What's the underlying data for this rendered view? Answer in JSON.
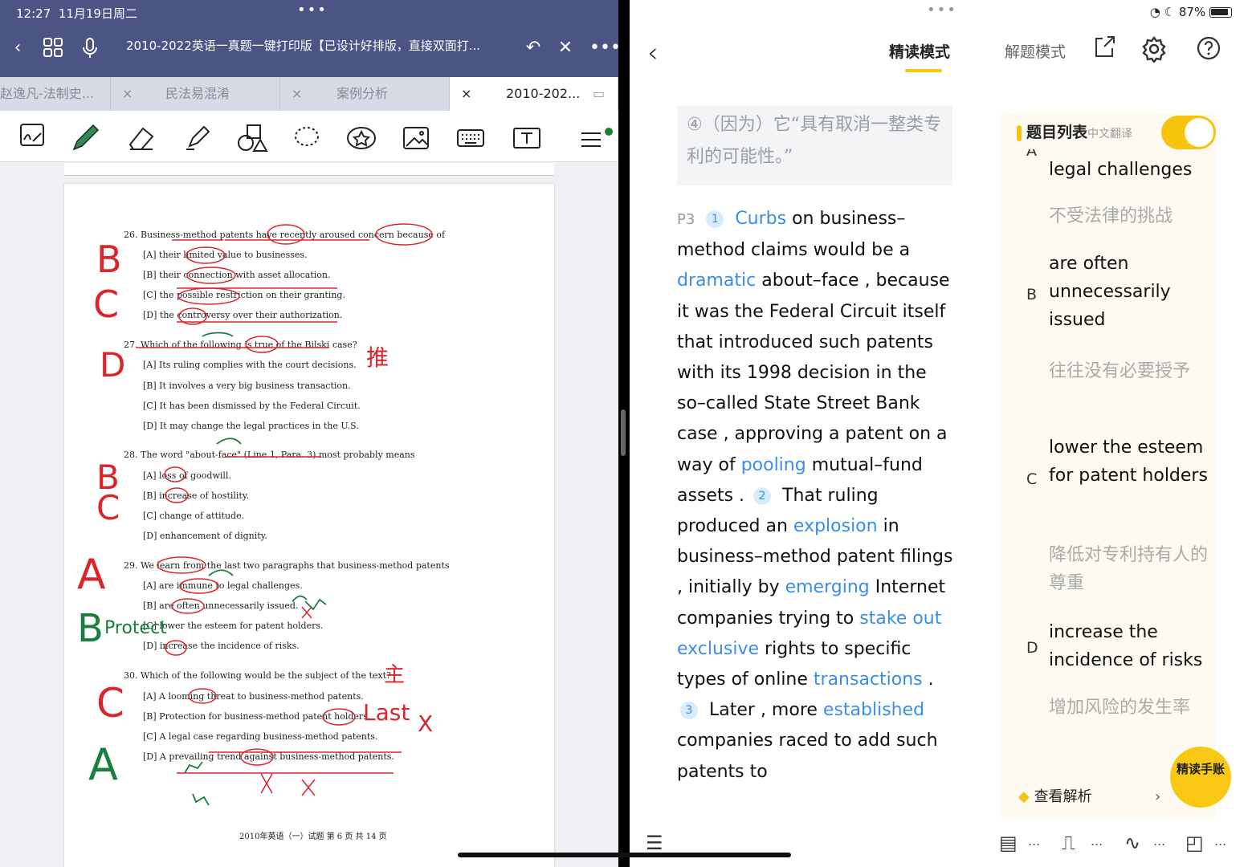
{
  "left": {
    "status": {
      "time": "12:27",
      "date": "11月19日周二",
      "dots": "•••"
    },
    "title": "2010-2022英语一真题一键打印版【已设计好排版，直接双面打...",
    "tabs": [
      {
        "label": "赵逸凡-法制史...",
        "close": "×"
      },
      {
        "label": "民法易混淆",
        "close": "×"
      },
      {
        "label": "案例分析",
        "close": "×"
      },
      {
        "label": "2010-202...",
        "close": "×"
      }
    ],
    "page": {
      "questions": [
        {
          "stem": "26. Business-method patents have recently aroused concern because of",
          "options": [
            "[A] their limited value to businesses.",
            "[B] their connection with asset allocation.",
            "[C] the possible restriction on their granting.",
            "[D] the controversy over their authorization."
          ]
        },
        {
          "stem": "27. Which of the following is true of the Bilski case?",
          "options": [
            "[A] Its ruling complies with the court decisions.",
            "[B] It involves a very big business transaction.",
            "[C] It has been dismissed by the Federal Circuit.",
            "[D] It may change the legal practices in the U.S."
          ]
        },
        {
          "stem": "28. The word \"about-face\" (Line 1, Para. 3) most probably means",
          "options": [
            "[A] loss of goodwill.",
            "[B] increase of hostility.",
            "[C] change of attitude.",
            "[D] enhancement of dignity."
          ]
        },
        {
          "stem": "29. We learn from the last two paragraphs that business-method patents",
          "options": [
            "[A] are immune to legal challenges.",
            "[B] are often unnecessarily issued.",
            "[C] lower the esteem for patent holders.",
            "[D] increase the incidence of risks."
          ]
        },
        {
          "stem": "30. Which of the following would be the subject of the text?",
          "options": [
            "[A] A looming threat to business-method patents.",
            "[B] Protection for business-method patent holders.",
            "[C] A legal case regarding business-method patents.",
            "[D] A prevailing trend against business-method patents."
          ]
        }
      ],
      "footer": "2010年英语（一）试题 第 6 页 共 14 页",
      "handwriting": [
        "B",
        "C",
        "D",
        "推",
        "B",
        "C",
        "A",
        "B",
        "Protect",
        "C",
        "A",
        "Last",
        "主",
        "X"
      ]
    }
  },
  "right": {
    "status": {
      "dots": "•••",
      "battery": "87%"
    },
    "nav": {
      "back": "‹",
      "tab_active": "精读模式",
      "tab_inactive": "解题模式"
    },
    "prev_sentence": "④（因为）它“具有取消一整类专利的可能性。”",
    "passage": [
      {
        "t": "P3",
        "k": "pn"
      },
      {
        "t": "1",
        "k": "badge"
      },
      {
        "t": "Curbs",
        "k": "kw"
      },
      {
        "t": " on business–method claims would be a ",
        "k": ""
      },
      {
        "t": "dramatic",
        "k": "kw"
      },
      {
        "t": " about–face , because it was the Federal Circuit  itself that introduced such patents with its 1998 decision in the so–called State Street Bank  case , approving a patent on a way of ",
        "k": ""
      },
      {
        "t": "pooling",
        "k": "kw"
      },
      {
        "t": " mutual–fund assets . ",
        "k": ""
      },
      {
        "t": "2",
        "k": "badge"
      },
      {
        "t": "That ruling produced an ",
        "k": ""
      },
      {
        "t": "explosion",
        "k": "kw"
      },
      {
        "t": " in business–method patent filings , initially by ",
        "k": ""
      },
      {
        "t": "emerging",
        "k": "kw"
      },
      {
        "t": " Internet companies trying to ",
        "k": ""
      },
      {
        "t": "stake out",
        "k": "kw"
      },
      {
        "t": "  ",
        "k": ""
      },
      {
        "t": "exclusive",
        "k": "kw"
      },
      {
        "t": " rights to specific types of online ",
        "k": ""
      },
      {
        "t": "transactions",
        "k": "kw"
      },
      {
        "t": " . ",
        "k": ""
      },
      {
        "t": "3",
        "k": "badge"
      },
      {
        "t": "Later , more ",
        "k": ""
      },
      {
        "t": "established",
        "k": "kw"
      },
      {
        "t": " companies raced to add such patents to",
        "k": ""
      }
    ],
    "panel": {
      "title": "题目列表",
      "subtitle": "中文翻译",
      "partial_letter": "A",
      "items": [
        {
          "letter": "",
          "en": "legal challenges",
          "zh": "不受法律的挑战"
        },
        {
          "letter": "B",
          "en": "are often unnecessarily issued",
          "zh": "往往没有必要授予"
        },
        {
          "letter": "C",
          "en": "lower the esteem for patent holders",
          "zh": "降低对专利持有人的尊重"
        },
        {
          "letter": "D",
          "en": "increase the incidence of risks",
          "zh": "增加风险的发生率"
        }
      ],
      "analysis": "查看解析",
      "mascot": "精读手账"
    },
    "bottom_dots": "..."
  }
}
